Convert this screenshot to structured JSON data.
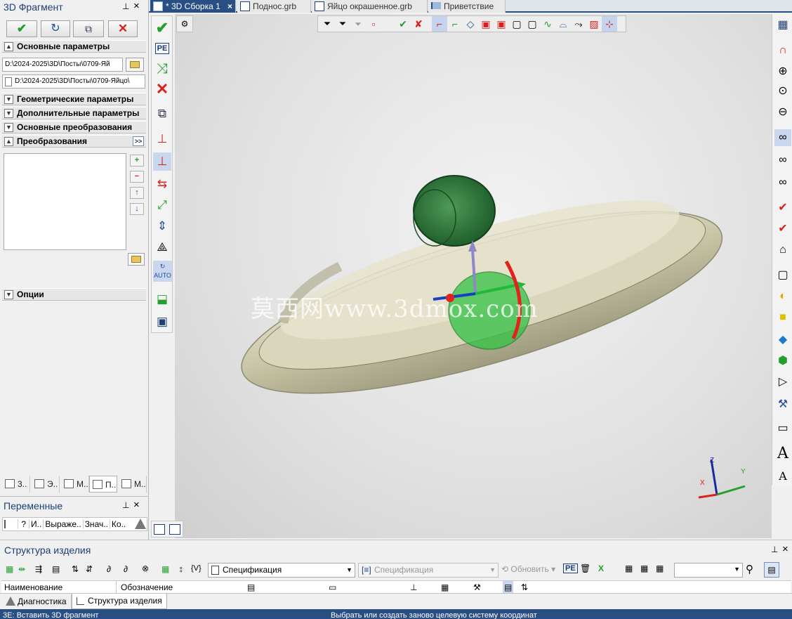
{
  "left_panel": {
    "title": "3D Фрагмент",
    "pin": "⊥",
    "close": "×",
    "sections": {
      "main_params": "Основные параметры",
      "geom": "Геометрические параметры",
      "extra": "Дополнительные параметры",
      "basic_transforms": "Основные преобразования",
      "transforms": "Преобразования",
      "options": "Опции"
    },
    "path1": "D:\\2024-2025\\3D\\Посты\\0709-Яй",
    "path2": "D:\\2024-2025\\3D\\Посты\\0709-Яйцо\\",
    "expand_btn": ">>",
    "bottom_tabs": [
      "3..",
      "Э..",
      "М..",
      "П..",
      "М.."
    ]
  },
  "vars_panel": {
    "title": "Переменные",
    "cols": [
      "?",
      "И..",
      "Выраже..",
      "Знач..",
      "Ко.."
    ]
  },
  "doc_tabs": [
    {
      "label": "* 3D Сборка 1",
      "active": true
    },
    {
      "label": "Поднос.grb",
      "active": false
    },
    {
      "label": "Яйцо окрашенное.grb",
      "active": false
    },
    {
      "label": "Приветствие",
      "active": false
    }
  ],
  "side_toolbar": {
    "auto_label": "AUTO"
  },
  "axes": {
    "x": "X",
    "y": "Y",
    "z": "Z"
  },
  "watermark": "莫西网www.3dmox.com",
  "structure_panel": {
    "title": "Структура изделия",
    "combo1": "Спецификация",
    "combo2": "Спецификация",
    "update": "Обновить",
    "col_name": "Наименование",
    "col_designation": "Обозначение"
  },
  "bottom_tabs": {
    "diagnostics": "Диагностика",
    "structure": "Структура изделия"
  },
  "status": {
    "left": "3Е: Вставить 3D фрагмент",
    "center": "Выбрать или создать заново целевую систему координат"
  },
  "colors": {
    "accent": "#1e3f78",
    "status_bar": "#294e84",
    "viewport": "#dcdcdc",
    "green_check": "#22a02c",
    "red_cross": "#d8201c"
  }
}
